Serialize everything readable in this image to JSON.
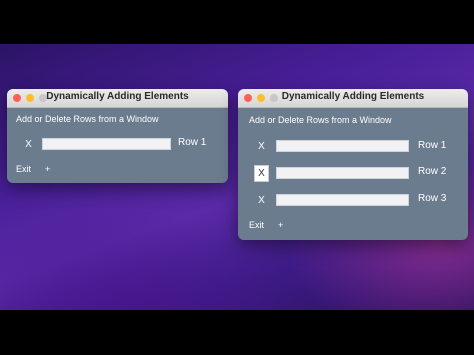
{
  "windows": [
    {
      "title": "Dynamically Adding Elements",
      "heading": "Add or Delete Rows from a Window",
      "rows": [
        {
          "delete": "X",
          "value": "",
          "label": "Row 1"
        }
      ],
      "exit_label": "Exit",
      "add_label": "+"
    },
    {
      "title": "Dynamically Adding Elements",
      "heading": "Add or Delete Rows from a Window",
      "rows": [
        {
          "delete": "X",
          "value": "",
          "label": "Row 1"
        },
        {
          "delete": "X",
          "value": "",
          "label": "Row 2"
        },
        {
          "delete": "X",
          "value": "",
          "label": "Row 3"
        }
      ],
      "exit_label": "Exit",
      "add_label": "+"
    }
  ]
}
